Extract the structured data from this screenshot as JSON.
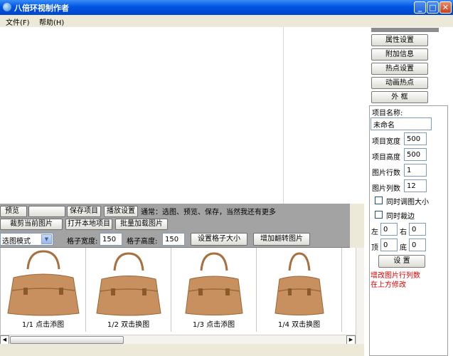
{
  "window": {
    "title": "八倍环视制作者",
    "minimize": "_",
    "maximize": "□",
    "close": "✕"
  },
  "menu": {
    "items": [
      {
        "label": "文件(F)"
      },
      {
        "label": "帮助(H)"
      }
    ]
  },
  "right_panel": {
    "buttons": [
      {
        "label": "属性设置"
      },
      {
        "label": "附加信息"
      },
      {
        "label": "热点设置"
      },
      {
        "label": "动画热点"
      },
      {
        "label": "外 框"
      }
    ],
    "project_name_label": "项目名称:",
    "project_name_value": "未命名",
    "width_label": "项目宽度",
    "width_value": "500",
    "height_label": "项目高度",
    "height_value": "500",
    "rows_label": "图片行数",
    "rows_value": "1",
    "cols_label": "图片列数",
    "cols_value": "12",
    "check_resize_label": "同时调图大小",
    "check_crop_label": "同时裁边",
    "left_label": "左",
    "left_value": "0",
    "right_label": "右",
    "right_value": "0",
    "top_label": "顶",
    "top_value": "0",
    "bottom_label": "底",
    "bottom_value": "0",
    "apply_button": "设 置",
    "note_line1": "增改图片行列数",
    "note_line2": "在上方修改"
  },
  "toolbar": {
    "preview": "预览",
    "save_project": "保存项目",
    "play_settings": "播放设置",
    "tip": "通常：选图、预览、保存，当然我还有更多",
    "crop_current": "裁剪当前图片",
    "open_local": "打开本地项目",
    "batch_load": "批量加载图片",
    "mode_value": "选图模式",
    "grid_width_label": "格子宽度:",
    "grid_width_value": "150",
    "grid_height_label": "格子高度:",
    "grid_height_value": "150",
    "set_grid_size": "设置格子大小",
    "add_flip": "增加翻转图片"
  },
  "gallery": {
    "items": [
      {
        "caption": "1/1 点击添图"
      },
      {
        "caption": "1/2 双击换图"
      },
      {
        "caption": "1/3 点击添图"
      },
      {
        "caption": "1/4 双击换图"
      }
    ]
  },
  "colors": {
    "accent": "#0054e3",
    "note": "#e00000",
    "bag": "#c9905f"
  }
}
